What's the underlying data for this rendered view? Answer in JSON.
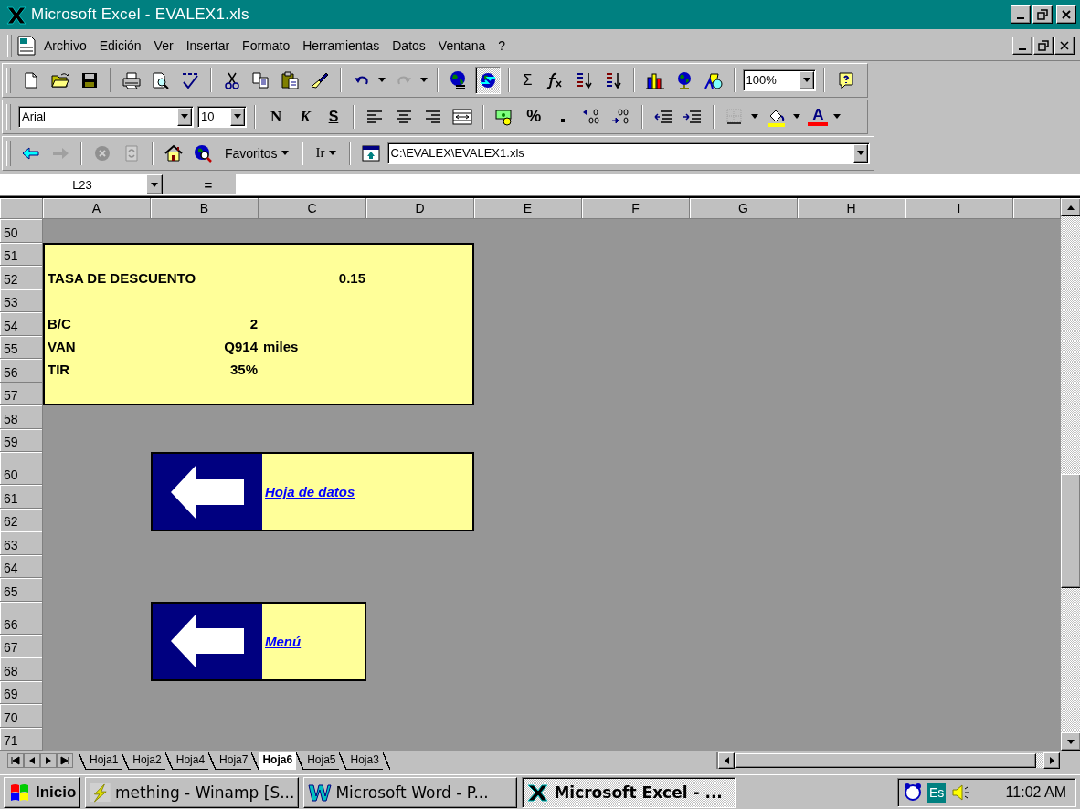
{
  "window": {
    "title": "Microsoft Excel - EVALEX1.xls"
  },
  "menu_bar": [
    {
      "label": "Archivo"
    },
    {
      "label": "Edición"
    },
    {
      "label": "Ver"
    },
    {
      "label": "Insertar"
    },
    {
      "label": "Formato"
    },
    {
      "label": "Herramientas"
    },
    {
      "label": "Datos"
    },
    {
      "label": "Ventana"
    },
    {
      "label": "?"
    }
  ],
  "standard_toolbar": {
    "autosum": "Σ",
    "web_toolbar_on": true,
    "zoom": "100%"
  },
  "formatting_toolbar": {
    "font": "Arial",
    "size": "10",
    "bold": "N",
    "italic": "K",
    "underline": "S",
    "percent": "%",
    "font_color": "A"
  },
  "web_toolbar": {
    "favorites": "Favoritos",
    "go": "Ir",
    "address": "C:\\EVALEX\\EVALEX1.xls"
  },
  "formula_bar": {
    "name_box": "L23",
    "equals": "="
  },
  "columns": [
    "A",
    "B",
    "C",
    "D",
    "E",
    "F",
    "G",
    "H",
    "I"
  ],
  "rows": [
    "50",
    "51",
    "52",
    "53",
    "54",
    "55",
    "56",
    "57",
    "58",
    "59",
    "60",
    "61",
    "62",
    "63",
    "64",
    "65",
    "66",
    "67",
    "68",
    "69",
    "70",
    "71"
  ],
  "summary_panel": {
    "rows": [
      {},
      {
        "column_a": "TASA DE DESCUENTO",
        "column_c": "0.15"
      },
      {},
      {
        "column_a": "B/C",
        "column_b": "2"
      },
      {
        "column_a": "VAN",
        "column_b": "Q914",
        "column_c": "miles"
      },
      {
        "column_a": "TIR",
        "column_b": "35%"
      },
      {}
    ]
  },
  "nav_buttons": [
    {
      "label": "Hoja de datos"
    },
    {
      "label": "Menú"
    }
  ],
  "sheet_tabs": [
    {
      "label": "Hoja1",
      "selected": false
    },
    {
      "label": "Hoja2",
      "selected": false
    },
    {
      "label": "Hoja4",
      "selected": false
    },
    {
      "label": "Hoja7",
      "selected": false
    },
    {
      "label": "Hoja6",
      "selected": true
    },
    {
      "label": "Hoja5",
      "selected": false
    },
    {
      "label": "Hoja3",
      "selected": false
    }
  ],
  "taskbar": {
    "start": "Inicio",
    "tasks": [
      {
        "label": "mething - Winamp [S...",
        "kind": "winamp",
        "selected": false
      },
      {
        "label": "Microsoft Word - P...",
        "kind": "word",
        "selected": false
      },
      {
        "label": "Microsoft Excel - ...",
        "kind": "excel",
        "selected": true
      }
    ],
    "language": "Es",
    "clock": "11:02 AM"
  }
}
